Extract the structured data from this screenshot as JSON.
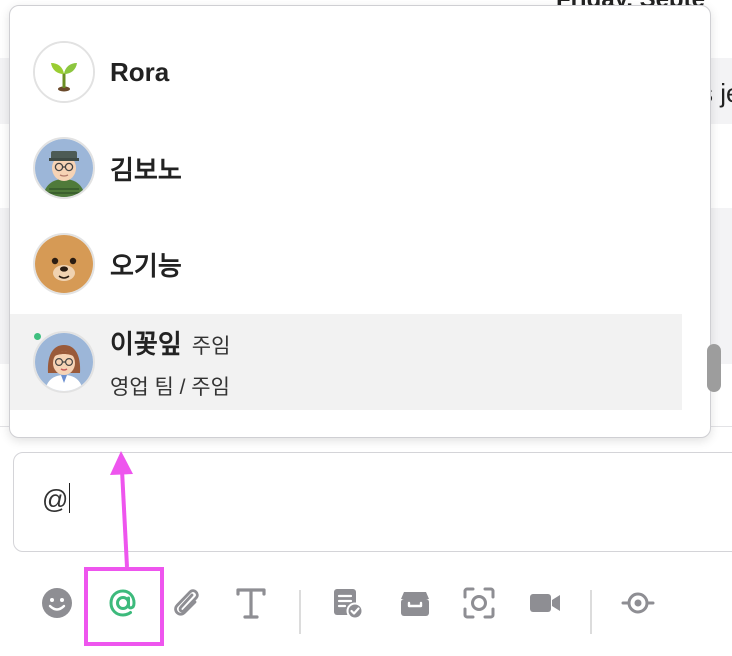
{
  "background": {
    "date_header": "Friday, Septe",
    "message_snippet": "s je"
  },
  "mention_list": {
    "items": [
      {
        "name": "Rora",
        "title": "",
        "subtitle": "",
        "avatar": "sprout-avatar",
        "online": false,
        "selected": false
      },
      {
        "name": "김보노",
        "title": "",
        "subtitle": "",
        "avatar": "man-cap-glasses-avatar",
        "online": false,
        "selected": false
      },
      {
        "name": "오기능",
        "title": "",
        "subtitle": "",
        "avatar": "bear-avatar",
        "online": false,
        "selected": false
      },
      {
        "name": "이꽃잎",
        "title": "주임",
        "subtitle": "영업 팀 / 주임",
        "avatar": "woman-glasses-avatar",
        "online": true,
        "selected": true
      }
    ]
  },
  "input": {
    "value": "@"
  },
  "toolbar": {
    "tools": [
      "emoji-icon",
      "mention-icon",
      "attach-icon",
      "text-format-icon",
      "task-icon",
      "archive-icon",
      "screenshot-icon",
      "video-icon",
      "plugin-icon"
    ]
  },
  "colors": {
    "mention_accent": "#3dba7c",
    "highlight": "#ee55ee",
    "online": "#3fbf7f",
    "icon_gray": "#8e8e93",
    "selected_row": "#f2f2f2"
  }
}
